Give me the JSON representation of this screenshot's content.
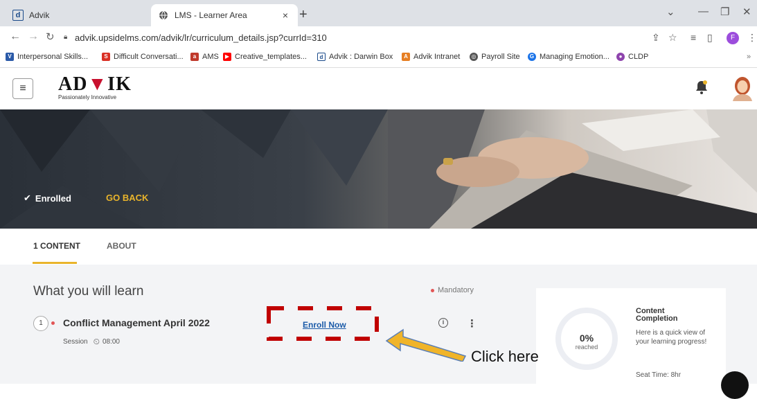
{
  "browser": {
    "tabs": [
      {
        "favicon": "d",
        "title": "Advik",
        "close": "×"
      },
      {
        "favicon": "globe-icon",
        "title": "LMS - Learner Area",
        "close": "×"
      }
    ],
    "new_tab": "+",
    "url": "advik.upsidelms.com/advik/lr/curriculum_details.jsp?currId=310",
    "profile_initial": "F",
    "bookmarks": [
      {
        "label": "Interpersonal Skills...",
        "color": "#2b5aa8"
      },
      {
        "label": "Difficult Conversati...",
        "color": "#d93025"
      },
      {
        "label": "AMS",
        "color": "#c0392b"
      },
      {
        "label": "Creative_templates...",
        "color": "#ff0000"
      },
      {
        "label": "Advik : Darwin Box",
        "color": "#2b5aa8"
      },
      {
        "label": "Advik Intranet",
        "color": "#e67e22"
      },
      {
        "label": "Payroll Site",
        "color": "#555555"
      },
      {
        "label": "Managing Emotion...",
        "color": "#1a73e8"
      },
      {
        "label": "CLDP",
        "color": "#8e44ad"
      }
    ],
    "more": "»"
  },
  "app": {
    "logo_text_1": "AD",
    "logo_text_v": "V",
    "logo_text_2": "IK",
    "logo_tagline": "Passionately Innovative"
  },
  "banner": {
    "status": "Enrolled",
    "go_back": "GO BACK"
  },
  "content_tabs": [
    {
      "label": "1 CONTENT",
      "active": true
    },
    {
      "label": "ABOUT",
      "active": false
    }
  ],
  "learn": {
    "title": "What you will learn",
    "mandatory": "Mandatory",
    "item": {
      "number": "1",
      "name": "Conflict Management April 2022",
      "type": "Session",
      "duration": "08:00",
      "action": "Enroll Now"
    }
  },
  "completion": {
    "percent": "0%",
    "reached": "reached",
    "title": "Content Completion",
    "description": "Here is a quick view of your learning progress!",
    "seat_time": "Seat Time: 8hr"
  },
  "annotation": {
    "text": "Click here",
    "color": "#c00000",
    "arrow_color": "#f0b429"
  }
}
